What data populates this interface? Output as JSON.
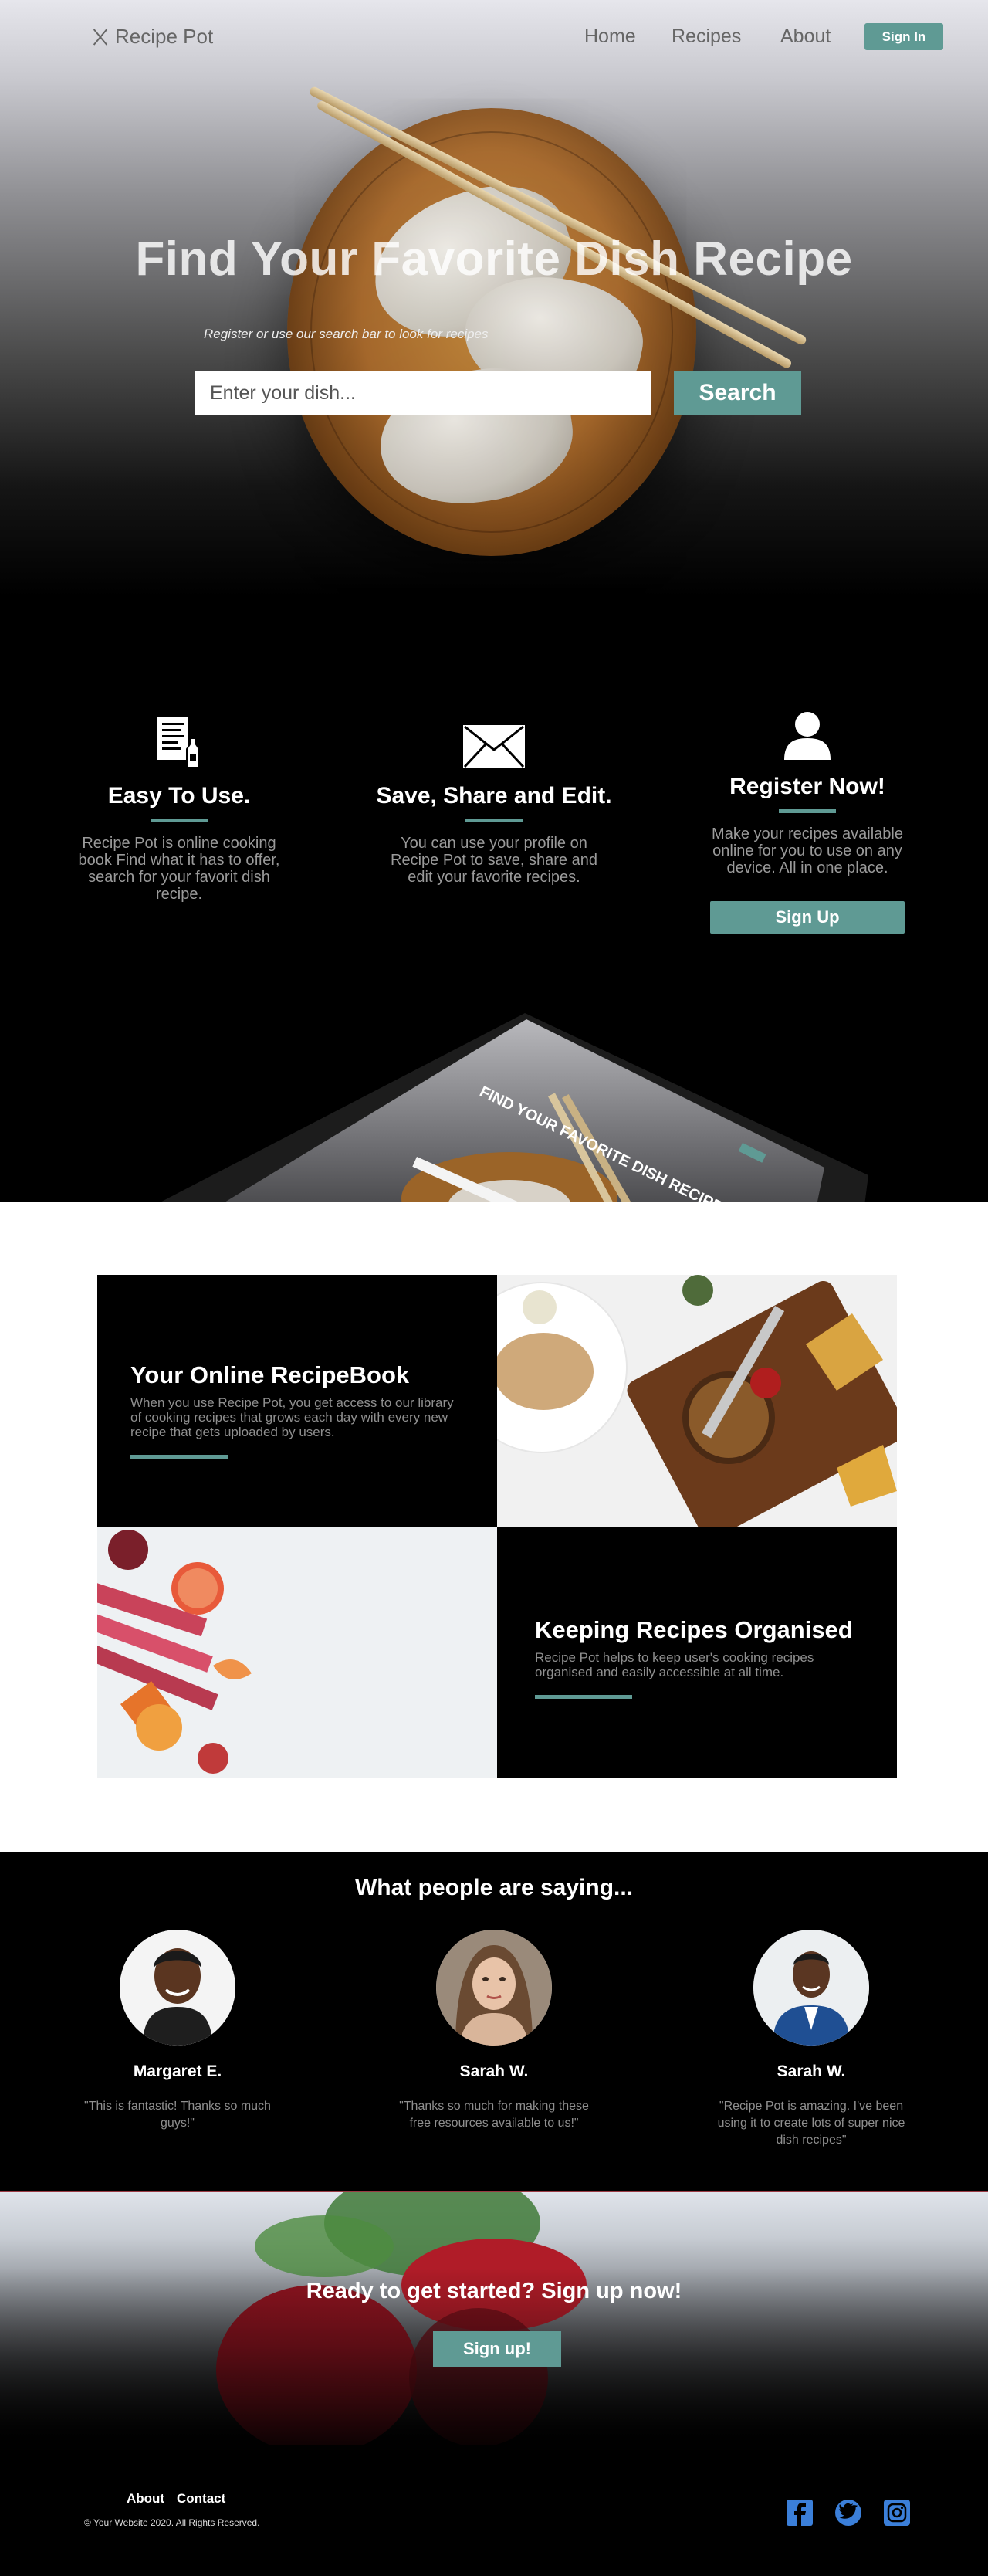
{
  "nav": {
    "brand": "Recipe Pot",
    "links": [
      "Home",
      "Recipes",
      "About"
    ],
    "signin_label": "Sign In"
  },
  "hero": {
    "title": "Find Your Favorite Dish Recipe",
    "subtitle": "Register or use our search bar to look for recipes",
    "search_placeholder": "Enter your dish...",
    "search_label": "Search"
  },
  "features": [
    {
      "icon": "recipe-book-icon",
      "title": "Easy To Use.",
      "text": "Recipe Pot is online cooking book Find what it has to offer, search for your favorit dish recipe."
    },
    {
      "icon": "envelope-icon",
      "title": "Save, Share and Edit.",
      "text": "You can use your profile on Recipe Pot to save, share and edit your favorite recipes."
    },
    {
      "icon": "user-icon",
      "title": "Register Now!",
      "text": "Make your recipes available online for you to use on any device. All in one place.",
      "button": "Sign Up"
    }
  ],
  "tablet": {
    "title": "FIND YOUR FAVORITE DISH RECIPE"
  },
  "showcase": [
    {
      "title": "Your Online RecipeBook",
      "text": "When you use Recipe Pot, you get access to our library of cooking recipes that grows each day with every new recipe that gets uploaded by users."
    },
    {
      "title": "Keeping Recipes Organised",
      "text": "Recipe Pot helps to keep user's cooking recipes organised and easily accessible at all time."
    }
  ],
  "testimonials": {
    "title": "What people are saying...",
    "people": [
      {
        "name": "Margaret E.",
        "quote": "\"This is fantastic! Thanks so much guys!\""
      },
      {
        "name": "Sarah W.",
        "quote": "\"Thanks so much for making these free resources available to us!\""
      },
      {
        "name": "Sarah W.",
        "quote": "\"Recipe Pot is amazing. I've been using it to create lots of super nice dish recipes\""
      }
    ]
  },
  "cta": {
    "title": "Ready to get started? Sign up now!",
    "button": "Sign up!"
  },
  "footer": {
    "links": [
      "About",
      "Contact"
    ],
    "copyright": "© Your Website 2020. All Rights Reserved.",
    "social": [
      "facebook-icon",
      "twitter-icon",
      "instagram-icon"
    ],
    "social_color": "#3b7fd9"
  },
  "colors": {
    "accent": "#5f9a94"
  }
}
